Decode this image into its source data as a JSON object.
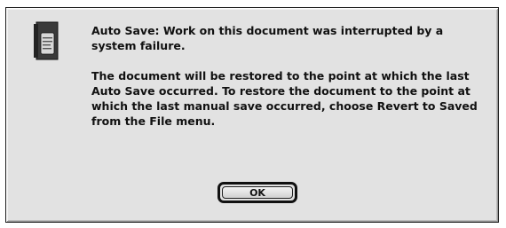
{
  "dialog": {
    "headline": "Auto Save: Work on this document was interrupted by a system failure.",
    "body": "The document will be restored to the point at which the last Auto Save occurred. To restore the document to the point at which the last manual save occurred, choose Revert to Saved from the File menu.",
    "icon": "document-alert-icon",
    "ok_label": "OK"
  }
}
